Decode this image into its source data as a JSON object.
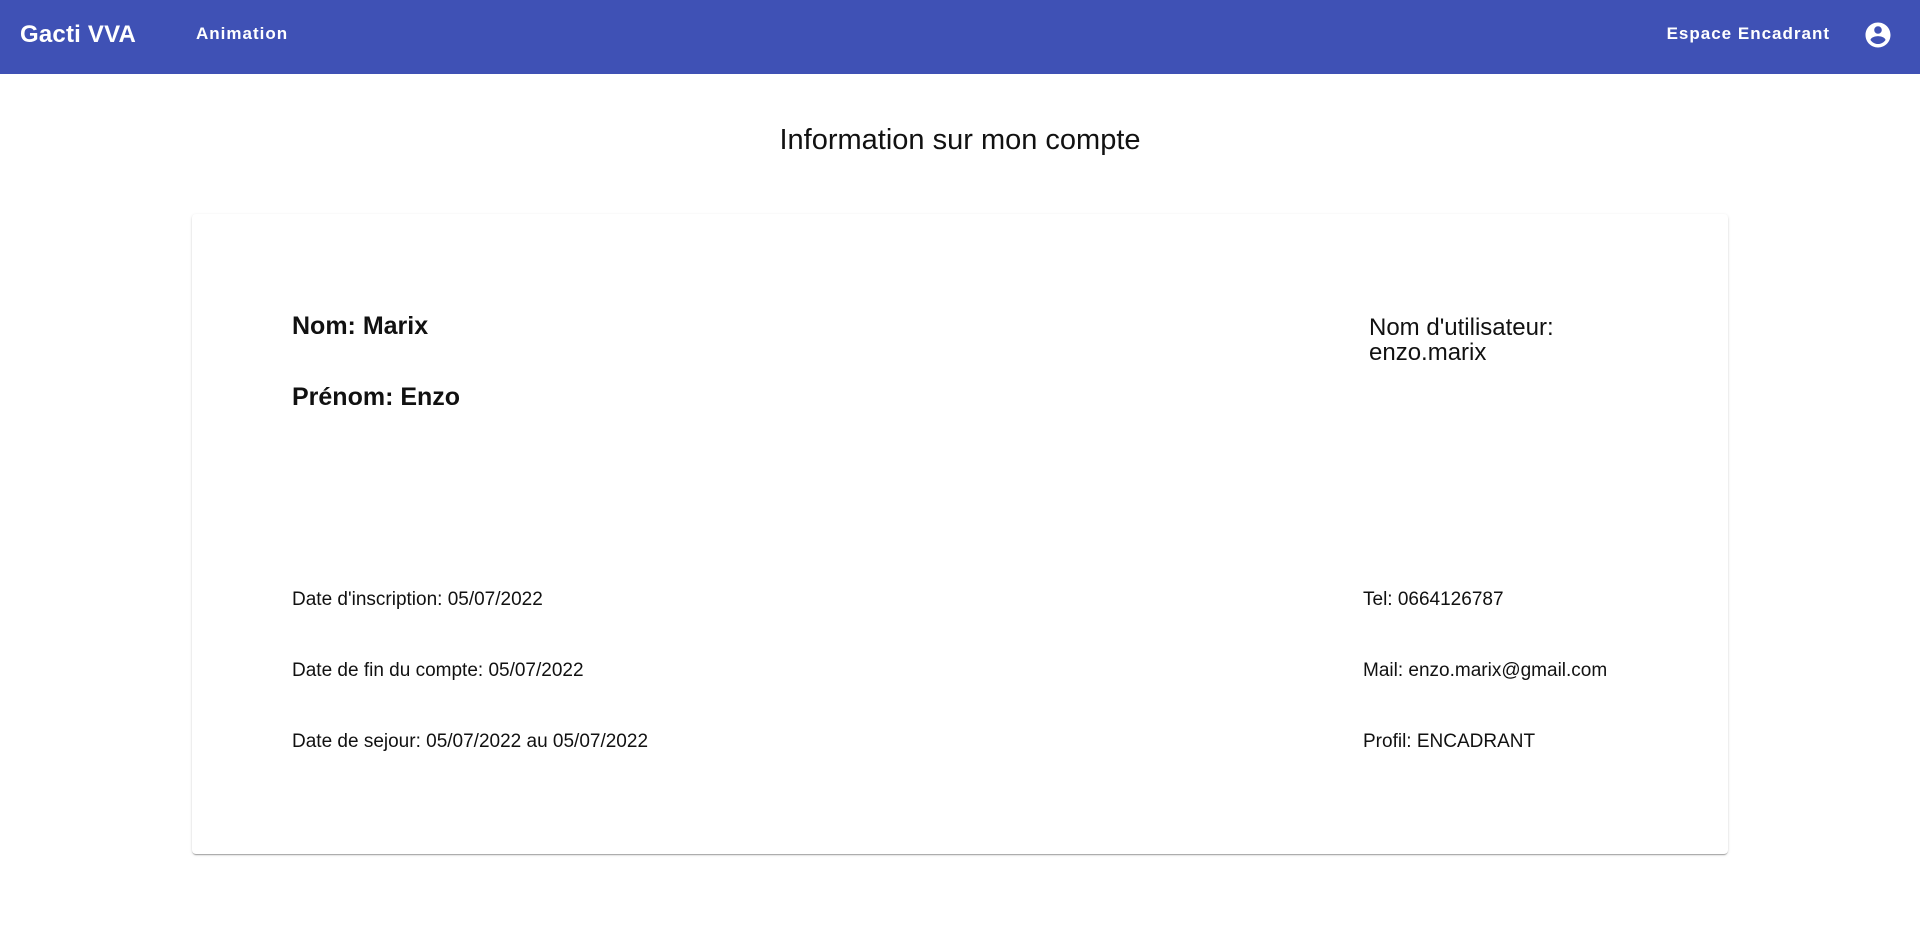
{
  "toolbar": {
    "brand": "Gacti VVA",
    "nav_animation": "Animation",
    "nav_espace": "Espace Encadrant",
    "account_icon": "account-circle-icon",
    "bg_color": "#3f51b5"
  },
  "page": {
    "title": "Information sur mon compte"
  },
  "account": {
    "nom": "Nom: Marix",
    "prenom": "Prénom: Enzo",
    "username_label": "Nom d'utilisateur:",
    "username_value": "enzo.marix",
    "date_inscription": "Date d'inscription: 05/07/2022",
    "date_fin": "Date de fin du compte: 05/07/2022",
    "date_sejour": "Date de sejour: 05/07/2022 au 05/07/2022",
    "tel": "Tel: 0664126787",
    "mail": "Mail: enzo.marix@gmail.com",
    "profil": "Profil: ENCADRANT"
  }
}
